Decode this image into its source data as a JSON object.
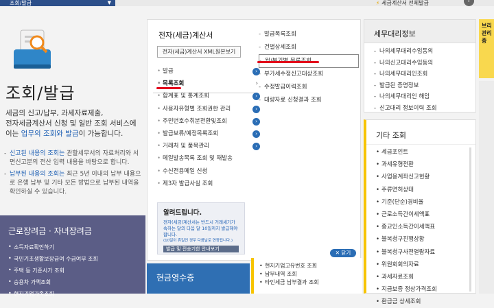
{
  "top": {
    "nav_label": "조회/발급",
    "right_text": "세금계산서 전체발급",
    "help": "?"
  },
  "hero": {
    "title": "조회/발급",
    "desc_prefix": "세금의 신고/납부, 과세자료제출,\n전자세금계산서 신청 및 일반 조회 서비스에\n이는 ",
    "desc_highlight": "업무의 조회와 발급",
    "desc_suffix": "이 가능합니다.",
    "notes": [
      {
        "hl": "신고된 내용의 조회는",
        "rest": " 관할세무서의 자료처리와 서면신고분의 전산 입력 내용을 바탕으로 합니다."
      },
      {
        "hl": "납부된 내용의 조회는",
        "rest": " 최근 5년 이내의 납부 내용으로 은행 납부 및 기타 모든 방법으로 납부된 내역을 확인하실 수 있습니다."
      }
    ]
  },
  "left_box": {
    "title": "근로장려금 · 자녀장려금",
    "items": [
      "소득자료확인하기",
      "국민기초생활보장급여 수급여부 조회",
      "주택 등 기준시가 조회",
      "승용차 가액조회",
      "현지기업가족조회"
    ]
  },
  "main": {
    "title": "전자(세금)계산서",
    "xml_button": "전자(세금)계산서 XML원본보기",
    "left_menu": [
      {
        "label": "발급",
        "go": true,
        "active": false
      },
      {
        "label": "목록조회",
        "go": false,
        "active": true
      },
      {
        "label": "합계표 및 통계조회",
        "go": true,
        "active": false
      },
      {
        "label": "사용자유형별 조회권한 관리",
        "go": true,
        "active": false
      },
      {
        "label": "주민번호수취분전환및조회",
        "go": true,
        "active": false
      },
      {
        "label": "발급보류/예정목록조회",
        "go": true,
        "active": false
      },
      {
        "label": "거래처 및 품목관리",
        "go": true,
        "active": false
      },
      {
        "label": "메일발송목록 조회 및 재발송",
        "go": false,
        "active": false
      },
      {
        "label": "수신전용메일 신청",
        "go": false,
        "active": false
      },
      {
        "label": "제3자 발급사실 조회",
        "go": false,
        "active": false
      }
    ],
    "active_chevron": "›",
    "go_glyph": "›",
    "right_menu": [
      {
        "label": "발급목록조회",
        "boxed": false
      },
      {
        "label": "건별상세조회",
        "boxed": false
      },
      {
        "label": "월/분기별 목록조회",
        "boxed": true
      },
      {
        "label": "부가세수정신고대상조회",
        "boxed": false
      },
      {
        "label": "수정발급이력조회",
        "boxed": false
      },
      {
        "label": "대량자료 신청결과 조회",
        "boxed": false
      }
    ],
    "notice": {
      "title": "알려드립니다.",
      "body": "전자(세금)계산서는 반드시 거래세기가 속하는 달의 다음 달 10일까지 발급해야 합니다.",
      "small": "(10일이 휴일인 경우 다음날로 연장됩니다.)",
      "bar": "발급 및 전송기한 안내보기"
    },
    "close_button": "✕ 닫기"
  },
  "cash": {
    "title": "현금영수증"
  },
  "yellow_list": [
    "현지기업고유번호 조회",
    "납부내역 조회",
    "타인세금 납부결과 조회"
  ],
  "tax_rep": {
    "title": "세무대리정보",
    "items": [
      "나의세무대리수임동의",
      "나의신고대리수임동의",
      "나의세무대리인조회",
      "발급된 증명정보",
      "나의세무대리인 해임",
      "신고대리 정보이력 조회"
    ]
  },
  "other": {
    "title": "기타 조회",
    "items": [
      "세금포인트",
      "과세유형전환",
      "사업용계좌신고현황",
      "주류면허상태",
      "기준(단순)경비율",
      "근로소득간이세액표",
      "종교인소득간이세액표",
      "불복청구진행상황",
      "불복청구사전열람자료",
      "위원회회의자료",
      "과세자료조회",
      "지급보증 정상가격조회",
      "환급금 상세조회"
    ]
  },
  "side": {
    "label": "브리 관리 중"
  },
  "colors": {
    "accent_blue": "#2a6db5",
    "red_mark": "#e3001b",
    "yellow": "#f7c400",
    "purple_box": "#5b5d86"
  }
}
